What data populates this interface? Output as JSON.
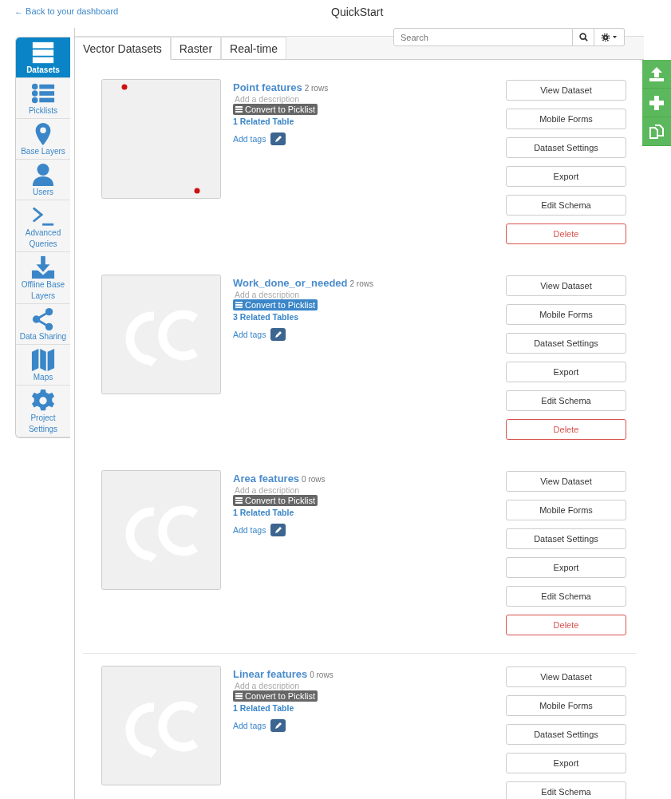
{
  "header": {
    "back_link": "← Back to your dashboard",
    "title": "QuickStart"
  },
  "sidebar": {
    "items": [
      {
        "label": "Datasets",
        "selected": true
      },
      {
        "label": "Picklists",
        "selected": false
      },
      {
        "label": "Base Layers",
        "selected": false
      },
      {
        "label": "Users",
        "selected": false
      },
      {
        "label": "Advanced Queries",
        "selected": false
      },
      {
        "label": "Offline Base Layers",
        "selected": false
      },
      {
        "label": "Data Sharing",
        "selected": false
      },
      {
        "label": "Maps",
        "selected": false
      },
      {
        "label": "Project Settings",
        "selected": false
      }
    ]
  },
  "tabs": [
    {
      "label": "Vector Datasets",
      "selected": true
    },
    {
      "label": "Raster",
      "selected": false
    },
    {
      "label": "Real-time",
      "selected": false
    }
  ],
  "search": {
    "placeholder": "Search"
  },
  "datasets": [
    {
      "name": "Point features",
      "rows": "2 rows",
      "description_placeholder": "Add a description",
      "convert_label": "Convert to Picklist",
      "convert_highlighted": false,
      "related": "1 Related Table",
      "tags_label": "Add tags",
      "thumbnail": {
        "kind": "points"
      },
      "divider_above": false,
      "buttons": [
        {
          "label": "View Dataset",
          "kind": "default"
        },
        {
          "label": "Mobile Forms",
          "kind": "default"
        },
        {
          "label": "Dataset Settings",
          "kind": "default"
        },
        {
          "label": "Export",
          "kind": "default"
        },
        {
          "label": "Edit Schema",
          "kind": "default"
        },
        {
          "label": "Delete",
          "kind": "danger"
        }
      ]
    },
    {
      "name": "Work_done_or_needed",
      "rows": "2 rows",
      "description_placeholder": "Add a description",
      "convert_label": "Convert to Picklist",
      "convert_highlighted": true,
      "related": "3 Related Tables",
      "tags_label": "Add tags",
      "thumbnail": {
        "kind": "logo"
      },
      "divider_above": false,
      "buttons": [
        {
          "label": "View Dataset",
          "kind": "default"
        },
        {
          "label": "Mobile Forms",
          "kind": "default"
        },
        {
          "label": "Dataset Settings",
          "kind": "default"
        },
        {
          "label": "Export",
          "kind": "default"
        },
        {
          "label": "Edit Schema",
          "kind": "default"
        },
        {
          "label": "Delete",
          "kind": "danger"
        }
      ]
    },
    {
      "name": "Area features",
      "rows": "0 rows",
      "description_placeholder": "Add a description",
      "convert_label": "Convert to Picklist",
      "convert_highlighted": false,
      "related": "1 Related Table",
      "tags_label": "Add tags",
      "thumbnail": {
        "kind": "logo"
      },
      "divider_above": false,
      "buttons": [
        {
          "label": "View Dataset",
          "kind": "default"
        },
        {
          "label": "Mobile Forms",
          "kind": "default"
        },
        {
          "label": "Dataset Settings",
          "kind": "default"
        },
        {
          "label": "Export",
          "kind": "default"
        },
        {
          "label": "Edit Schema",
          "kind": "default"
        },
        {
          "label": "Delete",
          "kind": "danger"
        }
      ]
    },
    {
      "name": "Linear features",
      "rows": "0 rows",
      "description_placeholder": "Add a description",
      "convert_label": "Convert to Picklist",
      "convert_highlighted": false,
      "related": "1 Related Table",
      "tags_label": "Add tags",
      "thumbnail": {
        "kind": "logo"
      },
      "divider_above": true,
      "buttons": [
        {
          "label": "View Dataset",
          "kind": "default"
        },
        {
          "label": "Mobile Forms",
          "kind": "default"
        },
        {
          "label": "Dataset Settings",
          "kind": "default"
        },
        {
          "label": "Export",
          "kind": "default"
        },
        {
          "label": "Edit Schema",
          "kind": "default"
        }
      ]
    }
  ]
}
